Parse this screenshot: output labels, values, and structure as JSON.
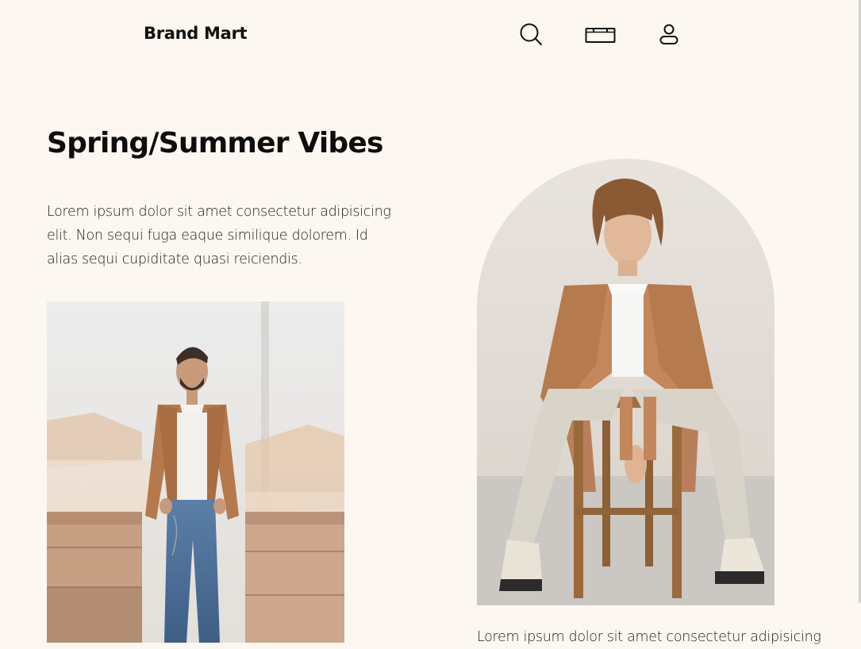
{
  "header": {
    "brand": "Brand Mart",
    "icons": [
      "search-icon",
      "briefcase-icon",
      "user-icon"
    ]
  },
  "hero": {
    "title": "Spring/Summer Vibes",
    "description": "Lorem ipsum dolor sit amet consectetur adipisicing elit. Non sequi fuga eaque similique dolorem. Id alias sequi cupiditate quasi reiciendis."
  },
  "secondary": {
    "description": "Lorem ipsum dolor sit amet consectetur adipisicing"
  },
  "colors": {
    "background": "#fcf8f1",
    "text": "#111111",
    "jacket": "#b6794c"
  }
}
